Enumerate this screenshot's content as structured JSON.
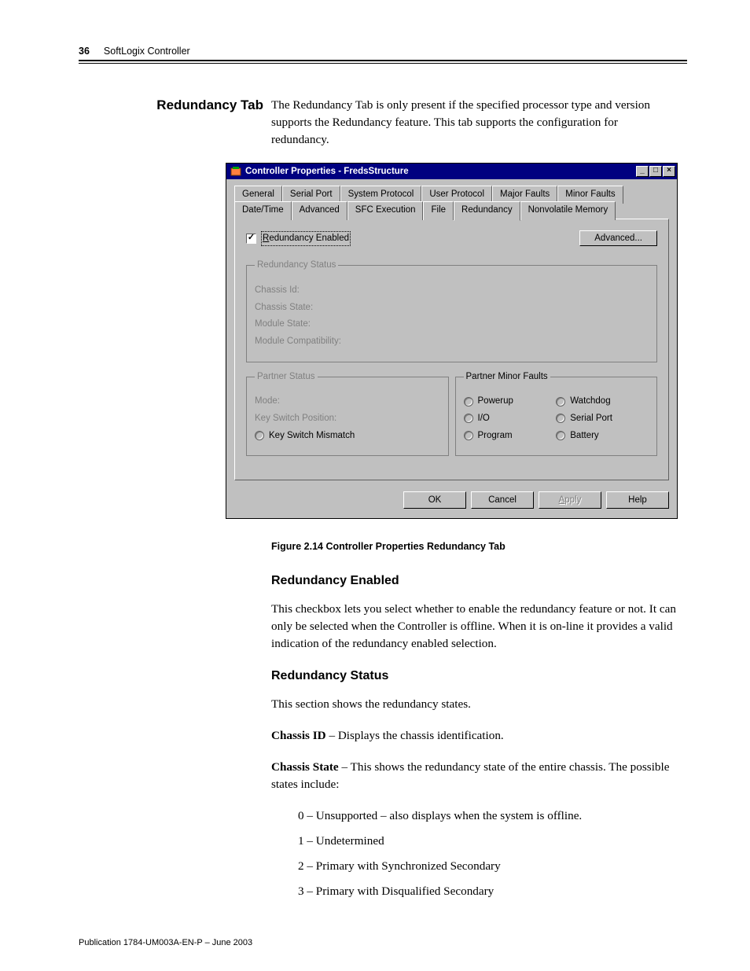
{
  "header": {
    "page_number": "36",
    "chapter": "SoftLogix Controller"
  },
  "side_heading": "Redundancy Tab",
  "intro_paragraph": "The Redundancy Tab is only present if the specified processor type and version supports the Redundancy feature. This tab supports the configuration for redundancy.",
  "dialog": {
    "title": "Controller Properties - FredsStructure",
    "tabs_row1": [
      "General",
      "Serial Port",
      "System Protocol",
      "User Protocol",
      "Major Faults",
      "Minor Faults"
    ],
    "tabs_row2": [
      "Date/Time",
      "Advanced",
      "SFC Execution",
      "File",
      "Redundancy",
      "Nonvolatile Memory"
    ],
    "active_tab": "Redundancy",
    "checkbox_label": "Redundancy Enabled",
    "checkbox_checked": "✓",
    "advanced_button": "Advanced...",
    "groups": {
      "redundancy_status": {
        "legend": "Redundancy Status",
        "fields": [
          "Chassis Id:",
          "Chassis State:",
          "Module State:",
          "Module Compatibility:"
        ]
      },
      "partner_status": {
        "legend": "Partner Status",
        "fields": [
          "Mode:",
          "Key Switch Position:"
        ],
        "radio": "Key Switch Mismatch"
      },
      "partner_minor_faults": {
        "legend": "Partner Minor Faults",
        "col1": [
          "Powerup",
          "I/O",
          "Program"
        ],
        "col2": [
          "Watchdog",
          "Serial Port",
          "Battery"
        ]
      }
    },
    "buttons": {
      "ok": "OK",
      "cancel": "Cancel",
      "apply": "Apply",
      "help": "Help"
    }
  },
  "figure_caption": "Figure 2.14 Controller Properties Redundancy Tab",
  "section_enabled": {
    "heading": "Redundancy Enabled",
    "body": "This checkbox lets you select whether to enable the redundancy feature or not. It can only be selected when the Controller is offline. When it is on-line it provides a valid indication of the redundancy enabled selection."
  },
  "section_status": {
    "heading": "Redundancy Status",
    "intro": "This section shows the redundancy states.",
    "chassis_id_term": "Chassis ID",
    "chassis_id_desc": " – Displays the chassis identification.",
    "chassis_state_term": "Chassis State",
    "chassis_state_desc": " – This shows the redundancy state of the entire chassis. The possible states include:",
    "states": [
      "0 – Unsupported – also displays when the system is offline.",
      "1 – Undetermined",
      "2 – Primary with Synchronized Secondary",
      "3 – Primary with Disqualified Secondary"
    ]
  },
  "footer": "Publication 1784-UM003A-EN-P – June 2003"
}
